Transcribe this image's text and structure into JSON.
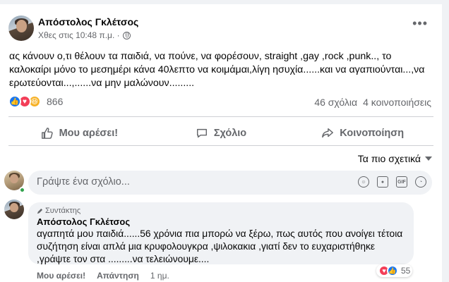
{
  "post": {
    "author": "Απόστολος Γκλέτσος",
    "time": "Χθες στις 10:48 π.μ. ·",
    "text": "ας κάνουν ο,τι θέλουν τα παιδιά,  να πούνε, να φορέσουν,  straight ,gay  ,rock ,punk.., το καλοκαίρι μόνο το μεσημέρι κάνα 40λεπτο να κοιμάμαι,λίγη ησυχία......και να  αγαπιούνται...,να ερωτεύονται...,......να μην μαλώνουν.........",
    "reaction_count": "866",
    "comments_count": "46 σχόλια",
    "shares_count": "4 κοινοποιήσεις",
    "more_icon": "more-horizontal-icon"
  },
  "actions": {
    "like_label": "Μου αρέσει!",
    "comment_label": "Σχόλιο",
    "share_label": "Κοινοποίηση"
  },
  "sort": {
    "label": "Τα πιο σχετικά"
  },
  "composer": {
    "placeholder": "Γράψτε ένα σχόλιο...",
    "gif_label": "GIF"
  },
  "comment": {
    "badge": "Συντάκτης",
    "author": "Απόστολος Γκλέτσος",
    "text": "αγαπητά μου παιδιά......56 χρόνια πια μπορώ να ξέρω, πως αυτός που ανοίγει τέτοια συζήτηση είναι απλά μια κρυφολουγκρα ,ψιλοκακια ,γιατί δεν το ευχαριστήθηκε ,γράψτε τον στα .........να τελειώνουμε....",
    "like_label": "Μου αρέσει!",
    "reply_label": "Απάντηση",
    "age": "1 ημ.",
    "reaction_count": "55"
  },
  "colors": {
    "like_blue": "#1877f2",
    "love_red": "#f33e58",
    "haha_yellow": "#f7b125",
    "online_green": "#31a24c"
  }
}
